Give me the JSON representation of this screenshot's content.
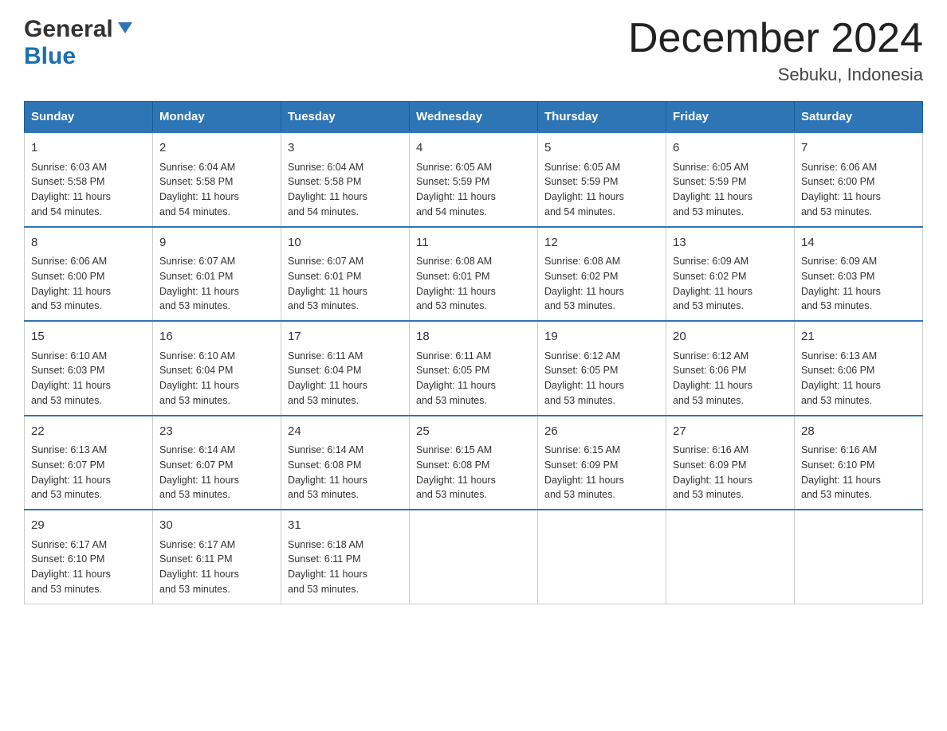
{
  "logo": {
    "general": "General",
    "blue": "Blue"
  },
  "title": "December 2024",
  "location": "Sebuku, Indonesia",
  "days_of_week": [
    "Sunday",
    "Monday",
    "Tuesday",
    "Wednesday",
    "Thursday",
    "Friday",
    "Saturday"
  ],
  "weeks": [
    [
      {
        "day": "1",
        "sunrise": "6:03 AM",
        "sunset": "5:58 PM",
        "daylight": "11 hours and 54 minutes."
      },
      {
        "day": "2",
        "sunrise": "6:04 AM",
        "sunset": "5:58 PM",
        "daylight": "11 hours and 54 minutes."
      },
      {
        "day": "3",
        "sunrise": "6:04 AM",
        "sunset": "5:58 PM",
        "daylight": "11 hours and 54 minutes."
      },
      {
        "day": "4",
        "sunrise": "6:05 AM",
        "sunset": "5:59 PM",
        "daylight": "11 hours and 54 minutes."
      },
      {
        "day": "5",
        "sunrise": "6:05 AM",
        "sunset": "5:59 PM",
        "daylight": "11 hours and 54 minutes."
      },
      {
        "day": "6",
        "sunrise": "6:05 AM",
        "sunset": "5:59 PM",
        "daylight": "11 hours and 53 minutes."
      },
      {
        "day": "7",
        "sunrise": "6:06 AM",
        "sunset": "6:00 PM",
        "daylight": "11 hours and 53 minutes."
      }
    ],
    [
      {
        "day": "8",
        "sunrise": "6:06 AM",
        "sunset": "6:00 PM",
        "daylight": "11 hours and 53 minutes."
      },
      {
        "day": "9",
        "sunrise": "6:07 AM",
        "sunset": "6:01 PM",
        "daylight": "11 hours and 53 minutes."
      },
      {
        "day": "10",
        "sunrise": "6:07 AM",
        "sunset": "6:01 PM",
        "daylight": "11 hours and 53 minutes."
      },
      {
        "day": "11",
        "sunrise": "6:08 AM",
        "sunset": "6:01 PM",
        "daylight": "11 hours and 53 minutes."
      },
      {
        "day": "12",
        "sunrise": "6:08 AM",
        "sunset": "6:02 PM",
        "daylight": "11 hours and 53 minutes."
      },
      {
        "day": "13",
        "sunrise": "6:09 AM",
        "sunset": "6:02 PM",
        "daylight": "11 hours and 53 minutes."
      },
      {
        "day": "14",
        "sunrise": "6:09 AM",
        "sunset": "6:03 PM",
        "daylight": "11 hours and 53 minutes."
      }
    ],
    [
      {
        "day": "15",
        "sunrise": "6:10 AM",
        "sunset": "6:03 PM",
        "daylight": "11 hours and 53 minutes."
      },
      {
        "day": "16",
        "sunrise": "6:10 AM",
        "sunset": "6:04 PM",
        "daylight": "11 hours and 53 minutes."
      },
      {
        "day": "17",
        "sunrise": "6:11 AM",
        "sunset": "6:04 PM",
        "daylight": "11 hours and 53 minutes."
      },
      {
        "day": "18",
        "sunrise": "6:11 AM",
        "sunset": "6:05 PM",
        "daylight": "11 hours and 53 minutes."
      },
      {
        "day": "19",
        "sunrise": "6:12 AM",
        "sunset": "6:05 PM",
        "daylight": "11 hours and 53 minutes."
      },
      {
        "day": "20",
        "sunrise": "6:12 AM",
        "sunset": "6:06 PM",
        "daylight": "11 hours and 53 minutes."
      },
      {
        "day": "21",
        "sunrise": "6:13 AM",
        "sunset": "6:06 PM",
        "daylight": "11 hours and 53 minutes."
      }
    ],
    [
      {
        "day": "22",
        "sunrise": "6:13 AM",
        "sunset": "6:07 PM",
        "daylight": "11 hours and 53 minutes."
      },
      {
        "day": "23",
        "sunrise": "6:14 AM",
        "sunset": "6:07 PM",
        "daylight": "11 hours and 53 minutes."
      },
      {
        "day": "24",
        "sunrise": "6:14 AM",
        "sunset": "6:08 PM",
        "daylight": "11 hours and 53 minutes."
      },
      {
        "day": "25",
        "sunrise": "6:15 AM",
        "sunset": "6:08 PM",
        "daylight": "11 hours and 53 minutes."
      },
      {
        "day": "26",
        "sunrise": "6:15 AM",
        "sunset": "6:09 PM",
        "daylight": "11 hours and 53 minutes."
      },
      {
        "day": "27",
        "sunrise": "6:16 AM",
        "sunset": "6:09 PM",
        "daylight": "11 hours and 53 minutes."
      },
      {
        "day": "28",
        "sunrise": "6:16 AM",
        "sunset": "6:10 PM",
        "daylight": "11 hours and 53 minutes."
      }
    ],
    [
      {
        "day": "29",
        "sunrise": "6:17 AM",
        "sunset": "6:10 PM",
        "daylight": "11 hours and 53 minutes."
      },
      {
        "day": "30",
        "sunrise": "6:17 AM",
        "sunset": "6:11 PM",
        "daylight": "11 hours and 53 minutes."
      },
      {
        "day": "31",
        "sunrise": "6:18 AM",
        "sunset": "6:11 PM",
        "daylight": "11 hours and 53 minutes."
      },
      {
        "day": "",
        "sunrise": "",
        "sunset": "",
        "daylight": ""
      },
      {
        "day": "",
        "sunrise": "",
        "sunset": "",
        "daylight": ""
      },
      {
        "day": "",
        "sunrise": "",
        "sunset": "",
        "daylight": ""
      },
      {
        "day": "",
        "sunrise": "",
        "sunset": "",
        "daylight": ""
      }
    ]
  ]
}
